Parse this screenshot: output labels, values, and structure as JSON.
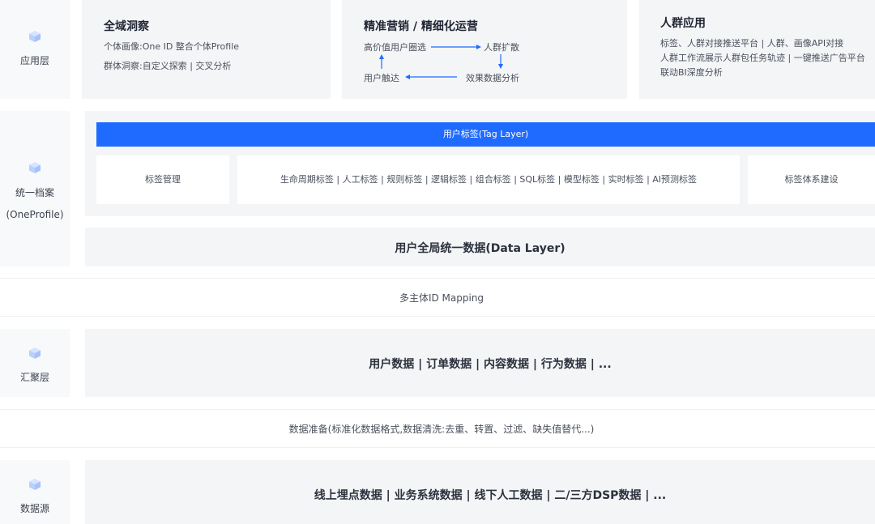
{
  "layers": {
    "application": "应用层",
    "profile": "统一档案",
    "profile_sub": "(OneProfile)",
    "aggregation": "汇聚层",
    "source": "数据源"
  },
  "cards": {
    "card1": {
      "title": "全域洞察",
      "line1": "个体画像:One ID 整合个体Profile",
      "line2": "群体洞察:自定义探索 | 交叉分析"
    },
    "card2": {
      "title": "精准营销 / 精细化运营",
      "flow": {
        "top_left": "高价值用户圈选",
        "top_right": "人群扩散",
        "bottom_left": "用户触达",
        "bottom_right": "效果数据分析"
      }
    },
    "card3": {
      "title": "人群应用",
      "line1": "标签、人群对接推送平台 | 人群、画像API对接",
      "line2": "人群工作流展示人群包任务轨迹 | 一键推送广告平台",
      "line3": "联动BI深度分析"
    }
  },
  "tag_layer": {
    "title": "用户标签(Tag Layer)",
    "left": "标签管理",
    "middle": "生命周期标签 | 人工标签 | 规则标签 | 逻辑标签 | 组合标签 | SQL标签 | 模型标签 | 实时标签 | AI预测标签",
    "right": "标签体系建设"
  },
  "data_layer": "用户全局统一数据(Data Layer)",
  "id_mapping": "多主体ID Mapping",
  "aggregation_data": "用户数据 | 订单数据 | 内容数据 | 行为数据 | ...",
  "data_prep": "数据准备(标准化数据格式,数据清洗:去重、转置、过滤、缺失值替代...)",
  "source_data": "线上埋点数据 | 业务系统数据 | 线下人工数据 | 二/三方DSP数据 | ...",
  "colors": {
    "accent": "#1f6bff",
    "panel": "#f4f5f7",
    "text": "#333a44"
  }
}
